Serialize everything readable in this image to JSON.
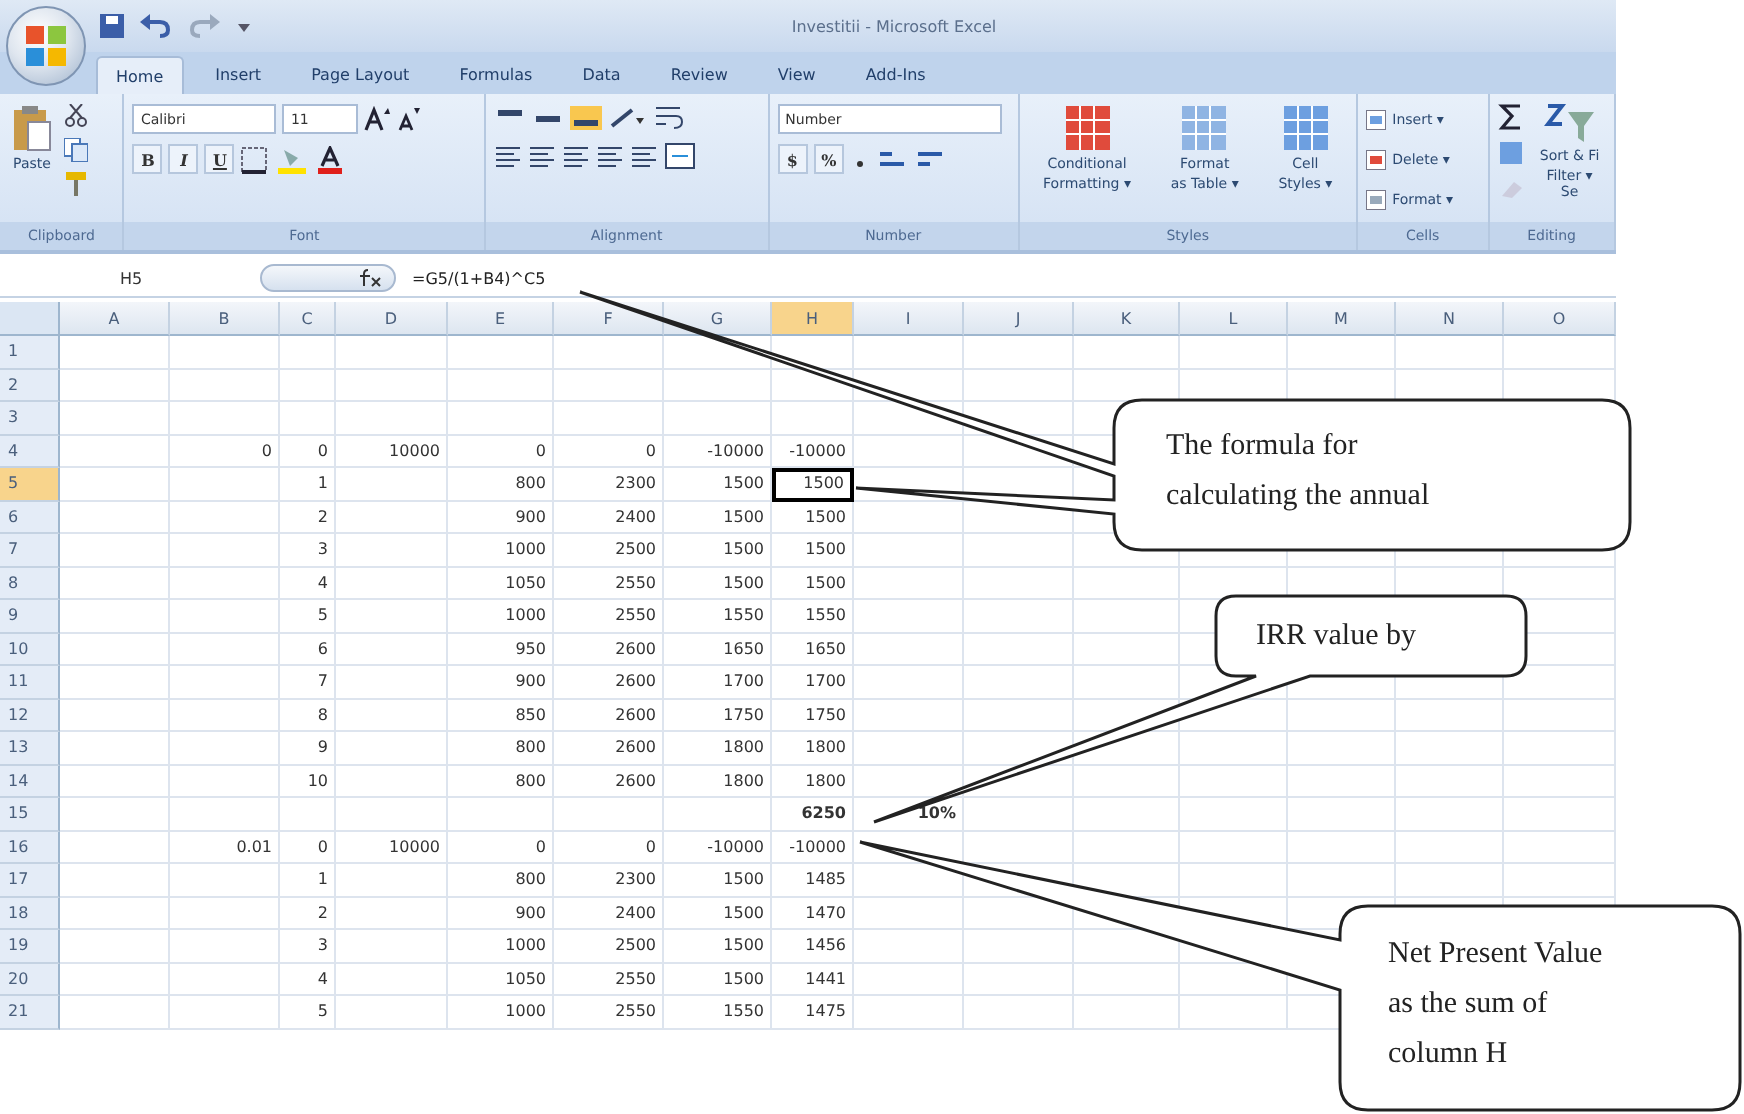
{
  "window": {
    "title": "Investitii - Microsoft Excel"
  },
  "tabs": [
    {
      "label": "Home",
      "selected": true
    },
    {
      "label": "Insert",
      "selected": false
    },
    {
      "label": "Page Layout",
      "selected": false
    },
    {
      "label": "Formulas",
      "selected": false
    },
    {
      "label": "Data",
      "selected": false
    },
    {
      "label": "Review",
      "selected": false
    },
    {
      "label": "View",
      "selected": false
    },
    {
      "label": "Add-Ins",
      "selected": false
    }
  ],
  "ribbon": {
    "clipboard": {
      "paste": "Paste",
      "label": "Clipboard"
    },
    "font": {
      "name": "Calibri",
      "size": "11",
      "format_buttons": [
        "B",
        "I",
        "U"
      ],
      "label": "Font"
    },
    "alignment": {
      "label": "Alignment"
    },
    "number": {
      "format": "Number",
      "symbols": [
        "$",
        "%"
      ],
      "label": "Number"
    },
    "styles": {
      "buttons": [
        {
          "top": "Conditional",
          "bottom": "Formatting ▾"
        },
        {
          "top": "Format",
          "bottom": "as Table ▾"
        },
        {
          "top": "Cell",
          "bottom": "Styles ▾"
        }
      ],
      "label": "Styles"
    },
    "cells": {
      "buttons": [
        "Insert ▾",
        "Delete ▾",
        "Format ▾"
      ],
      "label": "Cells"
    },
    "editing": {
      "sort_top": "Sort & Fi",
      "sort_bottom": "Filter ▾ Se",
      "label": "Editing"
    }
  },
  "formula_bar": {
    "name_box": "H5",
    "formula": "=G5/(1+B4)^C5"
  },
  "columns": [
    {
      "label": "A",
      "selected": false
    },
    {
      "label": "B",
      "selected": false
    },
    {
      "label": "C",
      "selected": false
    },
    {
      "label": "D",
      "selected": false
    },
    {
      "label": "E",
      "selected": false
    },
    {
      "label": "F",
      "selected": false
    },
    {
      "label": "G",
      "selected": false
    },
    {
      "label": "H",
      "selected": true
    },
    {
      "label": "I",
      "selected": false
    },
    {
      "label": "J",
      "selected": false
    },
    {
      "label": "K",
      "selected": false
    },
    {
      "label": "L",
      "selected": false
    },
    {
      "label": "M",
      "selected": false
    },
    {
      "label": "N",
      "selected": false
    },
    {
      "label": "O",
      "selected": false
    }
  ],
  "rows": [
    {
      "number": "1",
      "selected": false,
      "kind": "data",
      "cells": []
    },
    {
      "number": "2",
      "selected": false,
      "kind": "data",
      "cells": []
    },
    {
      "number": "3",
      "selected": false,
      "kind": "data",
      "cells": []
    },
    {
      "number": "4",
      "selected": false,
      "kind": "data",
      "cells": [
        null,
        "0",
        "0",
        "10000",
        "0",
        "0",
        "-10000",
        "-10000"
      ]
    },
    {
      "number": "5",
      "selected": true,
      "kind": "data",
      "cells": [
        null,
        null,
        "1",
        null,
        "800",
        "2300",
        "1500",
        "1500"
      ]
    },
    {
      "number": "6",
      "selected": false,
      "kind": "data",
      "cells": [
        null,
        null,
        "2",
        null,
        "900",
        "2400",
        "1500",
        "1500"
      ]
    },
    {
      "number": "7",
      "selected": false,
      "kind": "data",
      "cells": [
        null,
        null,
        "3",
        null,
        "1000",
        "2500",
        "1500",
        "1500"
      ]
    },
    {
      "number": "8",
      "selected": false,
      "kind": "data",
      "cells": [
        null,
        null,
        "4",
        null,
        "1050",
        "2550",
        "1500",
        "1500"
      ]
    },
    {
      "number": "9",
      "selected": false,
      "kind": "data",
      "cells": [
        null,
        null,
        "5",
        null,
        "1000",
        "2550",
        "1550",
        "1550"
      ]
    },
    {
      "number": "10",
      "selected": false,
      "kind": "data",
      "cells": [
        null,
        null,
        "6",
        null,
        "950",
        "2600",
        "1650",
        "1650"
      ]
    },
    {
      "number": "11",
      "selected": false,
      "kind": "data",
      "cells": [
        null,
        null,
        "7",
        null,
        "900",
        "2600",
        "1700",
        "1700"
      ]
    },
    {
      "number": "12",
      "selected": false,
      "kind": "data",
      "cells": [
        null,
        null,
        "8",
        null,
        "850",
        "2600",
        "1750",
        "1750"
      ]
    },
    {
      "number": "13",
      "selected": false,
      "kind": "data",
      "cells": [
        null,
        null,
        "9",
        null,
        "800",
        "2600",
        "1800",
        "1800"
      ]
    },
    {
      "number": "14",
      "selected": false,
      "kind": "data",
      "cells": [
        null,
        null,
        "10",
        null,
        "800",
        "2600",
        "1800",
        "1800"
      ]
    },
    {
      "number": "15",
      "selected": false,
      "kind": "total",
      "cells": [
        null,
        null,
        null,
        null,
        null,
        null,
        null,
        "6250",
        "10%"
      ]
    },
    {
      "number": "16",
      "selected": false,
      "kind": "data",
      "cells": [
        null,
        "0.01",
        "0",
        "10000",
        "0",
        "0",
        "-10000",
        "-10000"
      ]
    },
    {
      "number": "17",
      "selected": false,
      "kind": "data",
      "cells": [
        null,
        null,
        "1",
        null,
        "800",
        "2300",
        "1500",
        "1485"
      ]
    },
    {
      "number": "18",
      "selected": false,
      "kind": "data",
      "cells": [
        null,
        null,
        "2",
        null,
        "900",
        "2400",
        "1500",
        "1470"
      ]
    },
    {
      "number": "19",
      "selected": false,
      "kind": "data",
      "cells": [
        null,
        null,
        "3",
        null,
        "1000",
        "2500",
        "1500",
        "1456"
      ]
    },
    {
      "number": "20",
      "selected": false,
      "kind": "data",
      "cells": [
        null,
        null,
        "4",
        null,
        "1050",
        "2550",
        "1500",
        "1441"
      ]
    },
    {
      "number": "21",
      "selected": false,
      "kind": "data",
      "cells": [
        null,
        null,
        "5",
        null,
        "1000",
        "2550",
        "1550",
        "1475"
      ]
    }
  ],
  "callouts": [
    {
      "lines": [
        "The formula for",
        "calculating the annual"
      ]
    },
    {
      "lines": [
        "IRR value by"
      ]
    },
    {
      "lines": [
        "Net Present  Value",
        "as the  sum of",
        "column H"
      ]
    }
  ]
}
